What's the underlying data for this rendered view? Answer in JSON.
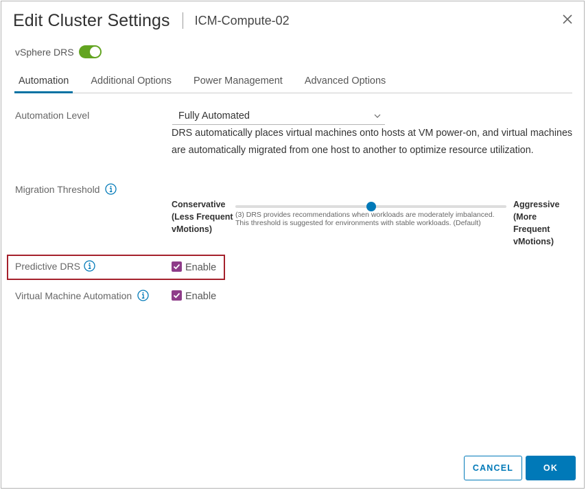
{
  "dialog": {
    "title": "Edit Cluster Settings",
    "subtitle": "ICM-Compute-02",
    "close_icon": "close-icon"
  },
  "drs": {
    "label": "vSphere DRS",
    "enabled": true,
    "toggle_color": "#62a420"
  },
  "tabs": [
    {
      "label": "Automation",
      "active": true
    },
    {
      "label": "Additional Options",
      "active": false
    },
    {
      "label": "Power Management",
      "active": false
    },
    {
      "label": "Advanced Options",
      "active": false
    }
  ],
  "automation": {
    "level_label": "Automation Level",
    "level_value": "Fully Automated",
    "level_description": "DRS automatically places virtual machines onto hosts at VM power-on, and virtual machines are automatically migrated from one host to another to optimize resource utilization."
  },
  "migration": {
    "label": "Migration Threshold",
    "left_label": "Conservative (Less Frequent vMotions)",
    "right_label": "Aggressive (More Frequent vMotions)",
    "level": 3,
    "levels": 5,
    "help_text": "(3) DRS provides recommendations when workloads are moderately imbalanced. This threshold is suggested for environments with stable workloads. (Default)"
  },
  "predictive": {
    "label": "Predictive DRS",
    "checkbox_label": "Enable",
    "checked": true
  },
  "vm_automation": {
    "label": "Virtual Machine Automation",
    "checkbox_label": "Enable",
    "checked": true
  },
  "buttons": {
    "cancel": "CANCEL",
    "ok": "OK"
  },
  "colors": {
    "accent": "#0079b8",
    "checkbox": "#8e3c89",
    "highlight": "#a4202b"
  }
}
